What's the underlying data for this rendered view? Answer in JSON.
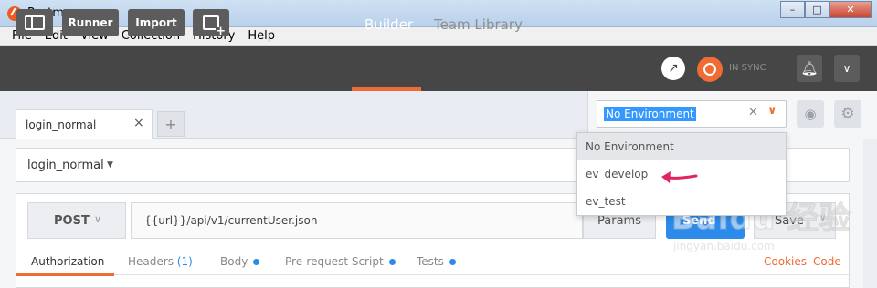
{
  "window": {
    "title": "Postman",
    "minimize": "–",
    "maximize": "□",
    "close": "✕"
  },
  "menu": [
    "File",
    "Edit",
    "View",
    "Collection",
    "History",
    "Help"
  ],
  "toolbar": {
    "runner": "Runner",
    "import": "Import",
    "tabs": [
      "Builder",
      "Team Library"
    ],
    "sync_status": "IN SYNC"
  },
  "request_tab": {
    "label": "login_normal",
    "close": "×",
    "add": "+"
  },
  "environment": {
    "selected": "No Environment",
    "clear": "✕",
    "options": [
      "No Environment",
      "ev_develop",
      "ev_test"
    ]
  },
  "collection": {
    "name": "login_normal"
  },
  "request": {
    "method": "POST",
    "url": "{{url}}/api/v1/currentUser.json",
    "params_label": "Params",
    "send_label": "Send",
    "save_label": "Save"
  },
  "subtabs": {
    "authorization": "Authorization",
    "headers": "Headers",
    "headers_count": "(1)",
    "body": "Body",
    "pre_request": "Pre-request Script",
    "tests": "Tests",
    "cookies": "Cookies",
    "code": "Code"
  },
  "watermark": {
    "brand": "Baidu 经验",
    "url": "jingyan.baidu.com"
  },
  "colors": {
    "accent": "#ef6c35",
    "primary": "#2b8aea",
    "toolbar": "#464646",
    "annotation_arrow": "#e0245e"
  },
  "icons": [
    "sidebar-toggle-icon",
    "new-window-icon",
    "satellite-icon",
    "sync-icon",
    "bell-icon",
    "chevron-down-icon",
    "eye-icon",
    "gear-icon",
    "arrow-annotation-icon"
  ]
}
